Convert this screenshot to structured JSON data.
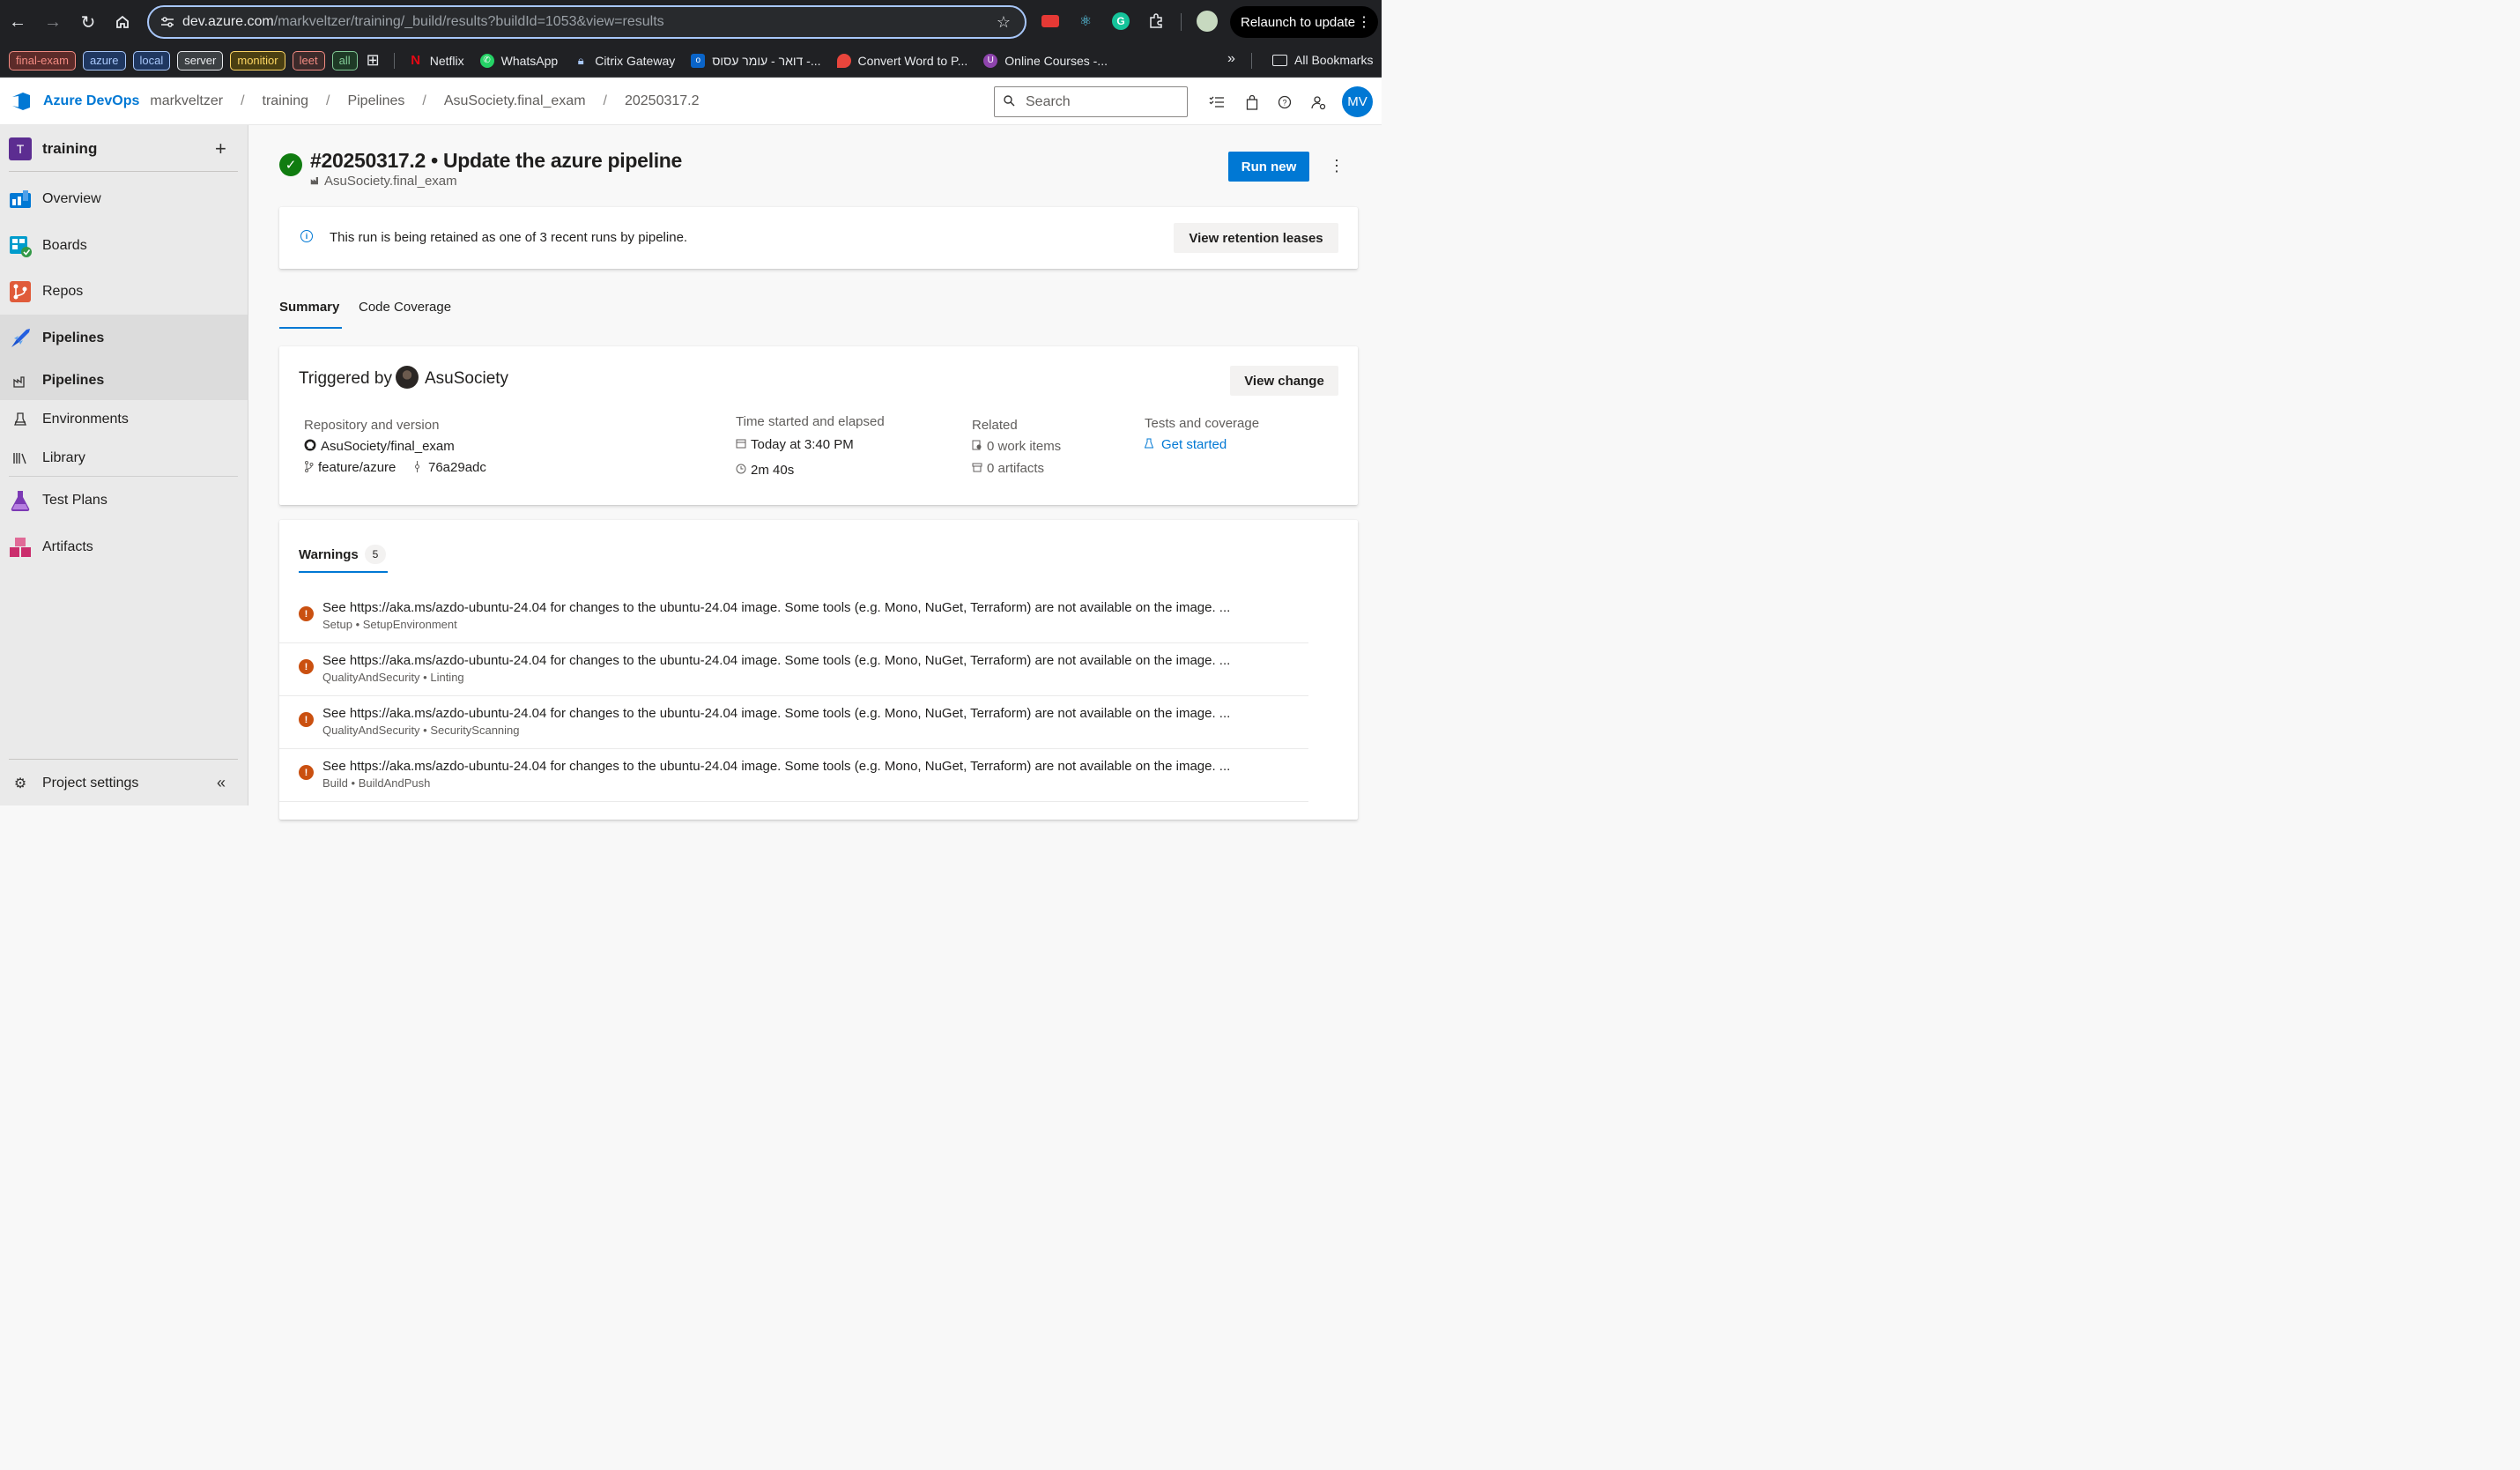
{
  "browser": {
    "url_host": "dev.azure.com",
    "url_path": "/markveltzer/training/_build/results?buildId=1053&view=results",
    "relaunch_label": "Relaunch to update",
    "bookmark_tags": [
      {
        "label": "final-exam",
        "color": "#f28b82",
        "bg": "#5c2b29"
      },
      {
        "label": "azure",
        "color": "#a8c7fa",
        "bg": "#1f3760"
      },
      {
        "label": "local",
        "color": "#a8c7fa",
        "bg": "#1f3760"
      },
      {
        "label": "server",
        "color": "#e8eaed",
        "bg": "#3c4043"
      },
      {
        "label": "monitior",
        "color": "#fdd663",
        "bg": "#4a3f12"
      },
      {
        "label": "leet",
        "color": "#f28b82",
        "bg": "#3c2a2a"
      },
      {
        "label": "all",
        "color": "#81c995",
        "bg": "#1e3a26"
      }
    ],
    "bookmarks": [
      "Netflix",
      "WhatsApp",
      "Citrix Gateway",
      "דואר - עומר עסוס -...",
      "Convert Word to P...",
      "Online Courses -..."
    ],
    "all_bookmarks_label": "All Bookmarks"
  },
  "header": {
    "brand": "Azure DevOps",
    "breadcrumbs": [
      "markveltzer",
      "training",
      "Pipelines",
      "AsuSociety.final_exam",
      "20250317.2"
    ],
    "search_placeholder": "Search",
    "avatar_initials": "MV"
  },
  "sidebar": {
    "project_initial": "T",
    "project_name": "training",
    "items": [
      {
        "label": "Overview",
        "color": "#0078d4"
      },
      {
        "label": "Boards",
        "color": "#009ccc"
      },
      {
        "label": "Repos",
        "color": "#e05b3a"
      },
      {
        "label": "Pipelines",
        "color": "#2560e0"
      },
      {
        "label": "Pipelines"
      },
      {
        "label": "Environments"
      },
      {
        "label": "Library"
      },
      {
        "label": "Test Plans",
        "color": "#7c3ab5"
      },
      {
        "label": "Artifacts",
        "color": "#cb2e6d"
      }
    ],
    "settings_label": "Project settings"
  },
  "run": {
    "title": "#20250317.2 • Update the azure pipeline",
    "pipeline": "AsuSociety.final_exam",
    "run_new_label": "Run new",
    "status": "succeeded"
  },
  "retention": {
    "message": "This run is being retained as one of 3 recent runs by pipeline.",
    "button_label": "View retention leases"
  },
  "tabs": [
    "Summary",
    "Code Coverage"
  ],
  "summary": {
    "triggered_by_label": "Triggered by",
    "triggered_by_user": "AsuSociety",
    "view_change_label": "View change",
    "repo_heading": "Repository and version",
    "repo_name": "AsuSociety/final_exam",
    "branch": "feature/azure",
    "commit": "76a29adc",
    "time_heading": "Time started and elapsed",
    "started": "Today at 3:40 PM",
    "elapsed": "2m 40s",
    "related_heading": "Related",
    "work_items": "0 work items",
    "artifacts": "0 artifacts",
    "tests_heading": "Tests and coverage",
    "tests_link": "Get started"
  },
  "warnings": {
    "tab_label": "Warnings",
    "count": "5",
    "items": [
      {
        "message": "See https://aka.ms/azdo-ubuntu-24.04 for changes to the ubuntu-24.04 image. Some tools (e.g. Mono, NuGet, Terraform) are not available on the image. ...",
        "stage": "Setup",
        "job": "SetupEnvironment"
      },
      {
        "message": "See https://aka.ms/azdo-ubuntu-24.04 for changes to the ubuntu-24.04 image. Some tools (e.g. Mono, NuGet, Terraform) are not available on the image. ...",
        "stage": "QualityAndSecurity",
        "job": "Linting"
      },
      {
        "message": "See https://aka.ms/azdo-ubuntu-24.04 for changes to the ubuntu-24.04 image. Some tools (e.g. Mono, NuGet, Terraform) are not available on the image. ...",
        "stage": "QualityAndSecurity",
        "job": "SecurityScanning"
      },
      {
        "message": "See https://aka.ms/azdo-ubuntu-24.04 for changes to the ubuntu-24.04 image. Some tools (e.g. Mono, NuGet, Terraform) are not available on the image. ...",
        "stage": "Build",
        "job": "BuildAndPush"
      }
    ]
  }
}
